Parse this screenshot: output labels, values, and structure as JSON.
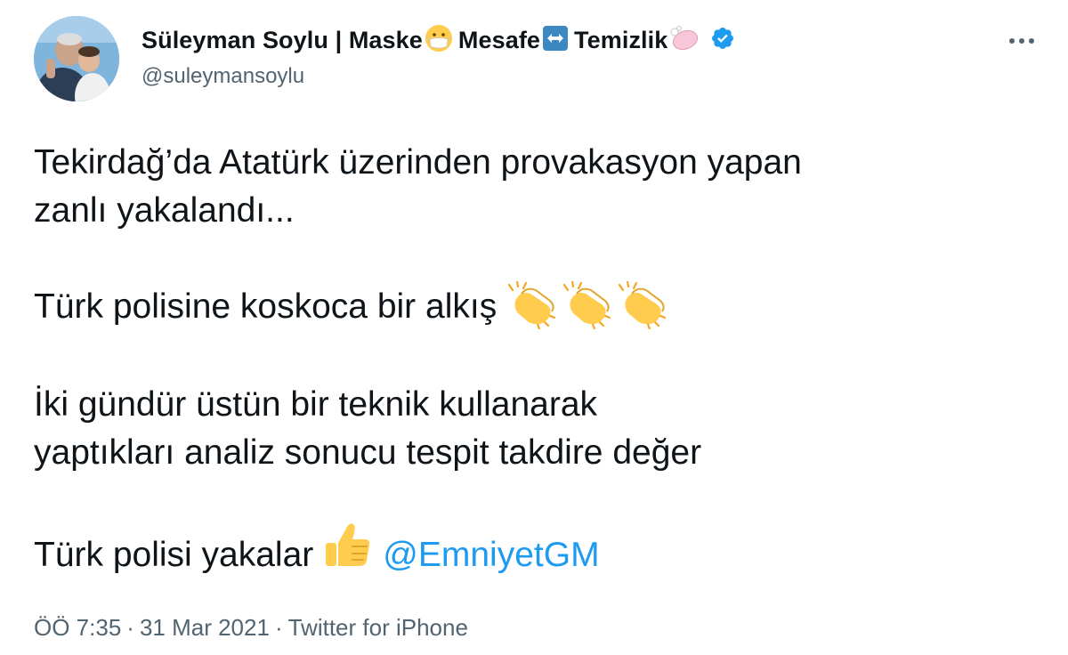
{
  "author": {
    "display_name": "Süleyman Soylu | Maske",
    "name_part_2": "Mesafe",
    "name_part_3": "Temizlik",
    "handle": "@suleymansoylu",
    "verified": true,
    "accent_color": "#1d9bf0"
  },
  "tweet": {
    "line_1": "Tekirdağ’da Atatürk üzerinden provakasyon yapan",
    "line_2": "zanlı yakalandı...",
    "line_3": "Türk polisine koskoca bir alkış",
    "line_4": "İki gündür üstün bir teknik kullanarak",
    "line_5": "yaptıkları analiz sonucu tespit takdire değer",
    "line_6": "Türk polisi yakalar",
    "mention": "@EmniyetGM"
  },
  "meta": {
    "time": "ÖÖ 7:35",
    "date": "31 Mar 2021",
    "source": "Twitter for iPhone",
    "separator": "·"
  },
  "icons": {
    "mask": "mask-face-emoji",
    "arrows": "left-right-arrow-emoji",
    "soap": "soap-emoji",
    "verified": "verified-badge-icon",
    "more": "more-dots-icon",
    "clap": "clapping-hands-emoji",
    "thumbs_up": "thumbs-up-emoji"
  }
}
